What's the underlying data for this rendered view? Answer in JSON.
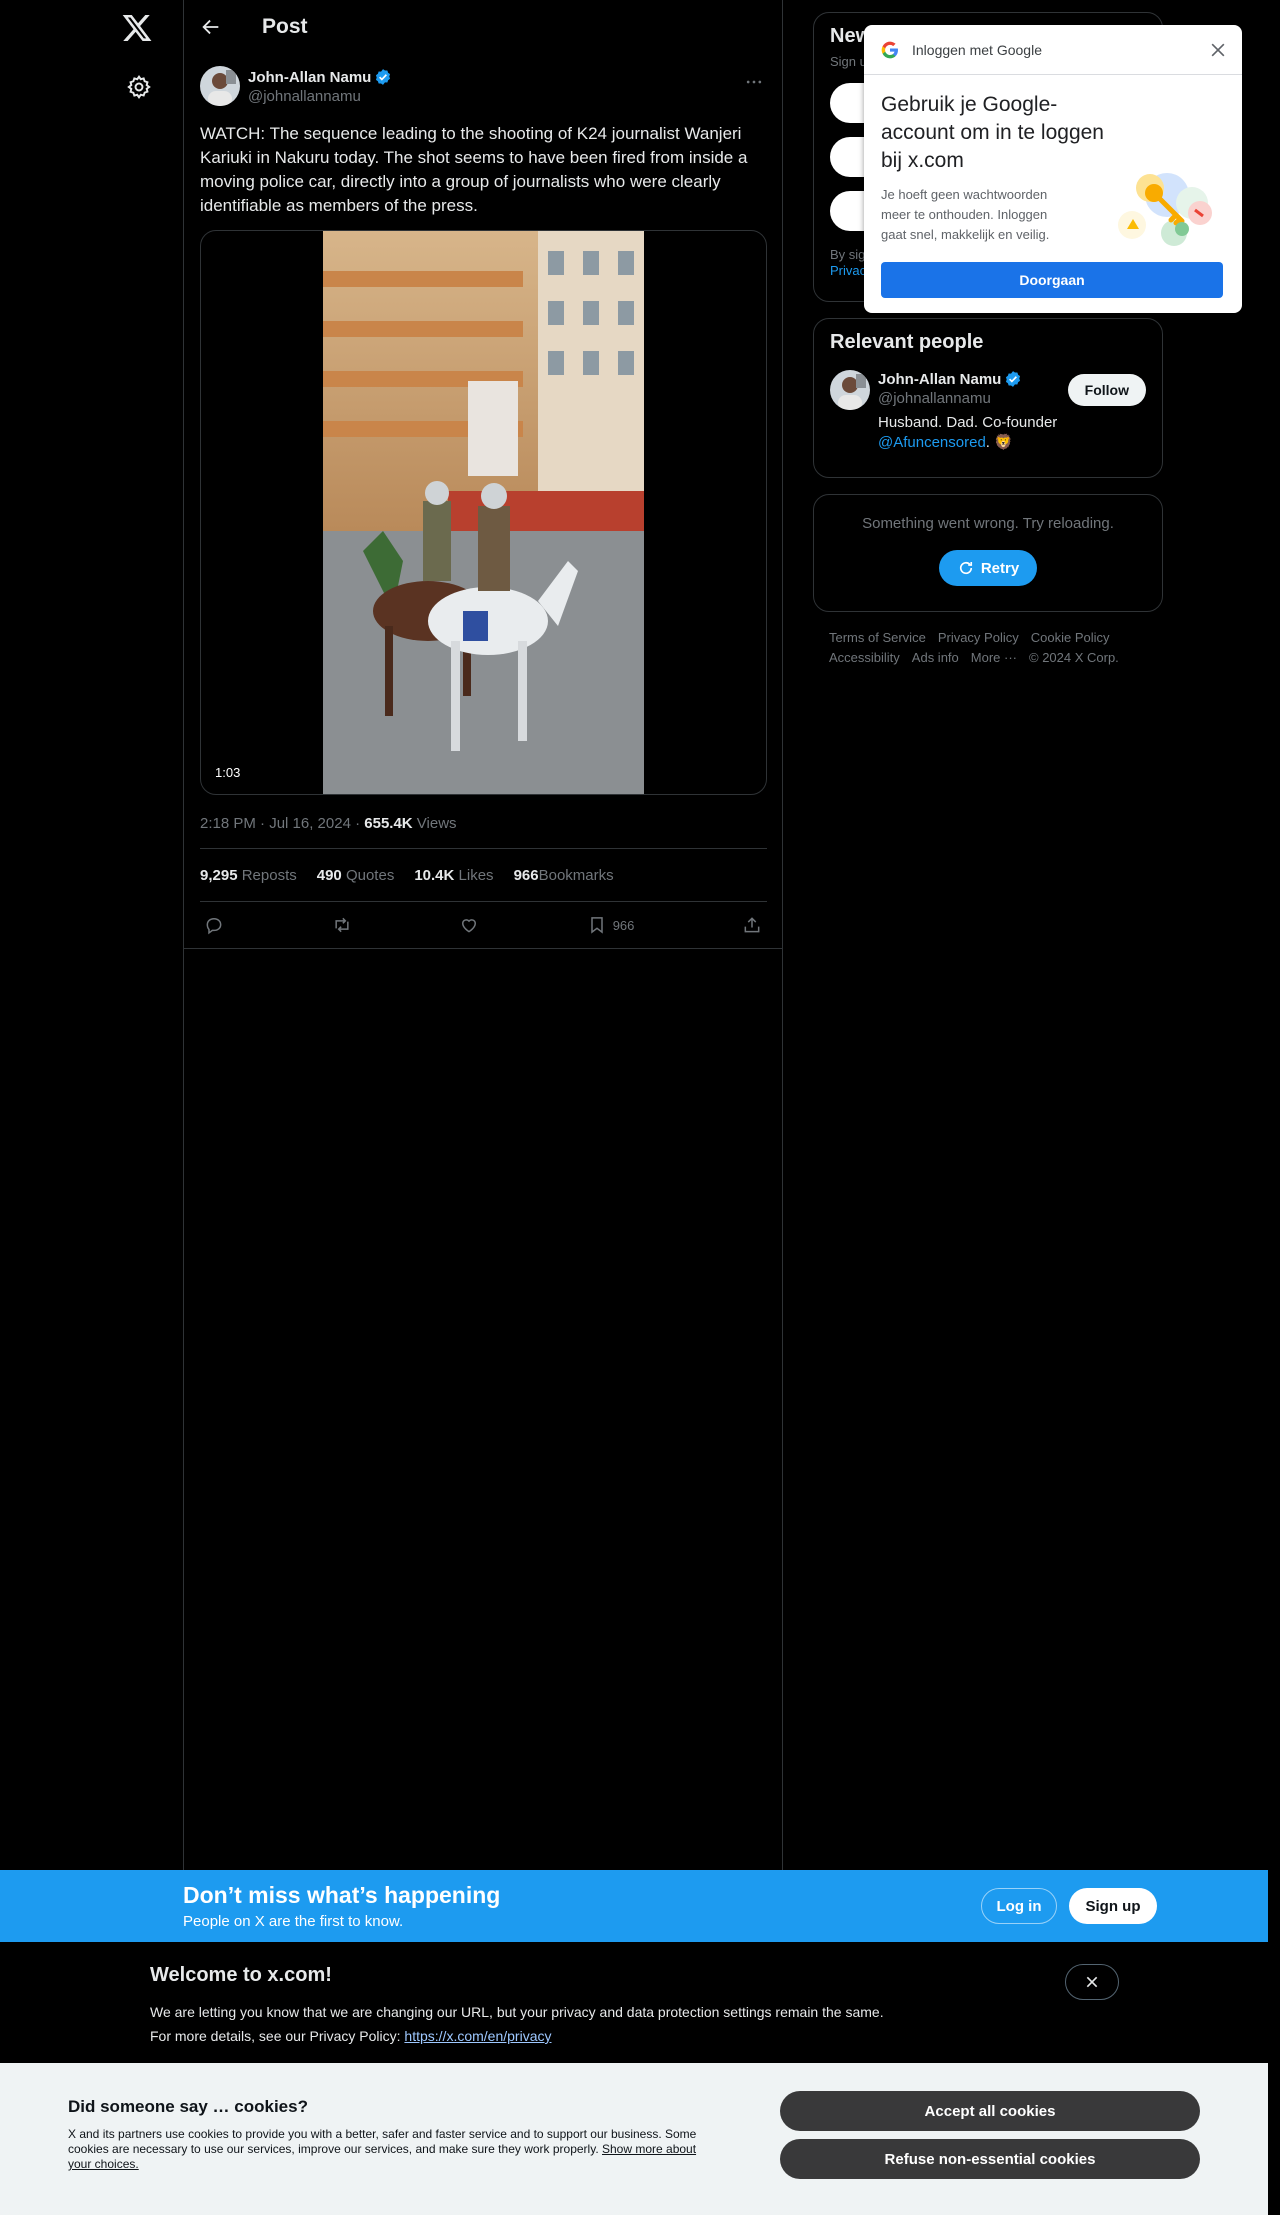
{
  "header": {
    "title": "Post"
  },
  "tweet": {
    "author_name": "John-Allan Namu",
    "author_handle": "@johnallannamu",
    "text": "WATCH: The sequence leading to the shooting of K24 journalist Wanjeri Kariuki in Nakuru today. The shot seems to have been fired from inside a moving police car, directly into a group of journalists who were clearly identifiable as members of the press.",
    "video_duration": "1:03",
    "time": "2:18 PM · Jul 16, 2024 · ",
    "views_count": "655.4K",
    "views_label": " Views",
    "stats": [
      {
        "count": "9,295",
        "label": "Reposts"
      },
      {
        "count": "490",
        "label": "Quotes"
      },
      {
        "count": "10.4K",
        "label": "Likes"
      },
      {
        "count": "966",
        "label": "Bookmarks"
      }
    ],
    "bookmark_count": "966"
  },
  "new_card": {
    "title": "New",
    "subtitle": "Sign u",
    "tos_prefix": "By sig",
    "tos_link": "Privac"
  },
  "relevant_people": {
    "title": "Relevant people",
    "name": "John-Allan Namu",
    "handle": "@johnallannamu",
    "bio": "Husband. Dad. Co-founder",
    "bio_mention": "@Afuncensored",
    "bio_suffix": ". 🦁",
    "follow_label": "Follow"
  },
  "error_card": {
    "message": "Something went wrong. Try reloading.",
    "retry_label": "Retry"
  },
  "footer": {
    "links": [
      "Terms of Service",
      "Privacy Policy",
      "Cookie Policy",
      "Accessibility",
      "Ads info",
      "More ···",
      "© 2024 X Corp."
    ]
  },
  "google_popup": {
    "header": "Inloggen met Google",
    "title": "Gebruik je Google-account om in te loggen bij x.com",
    "body": "Je hoeft geen wachtwoorden meer te onthouden. Inloggen gaat snel, makkelijk en veilig.",
    "button": "Doorgaan"
  },
  "dont_miss": {
    "title": "Don’t miss what’s happening",
    "subtitle": "People on X are the first to know.",
    "login": "Log in",
    "signup": "Sign up"
  },
  "welcome": {
    "title": "Welcome to x.com!",
    "line1": "We are letting you know that we are changing our URL, but your privacy and data protection settings remain the same.",
    "line2": "For more details, see our Privacy Policy: ",
    "link": "https://x.com/en/privacy"
  },
  "cookies": {
    "title": "Did someone say … cookies?",
    "text": "X and its partners use cookies to provide you with a better, safer and faster service and to support our business. Some cookies are necessary to use our services, improve our services, and make sure they work properly. ",
    "link": "Show more about your choices.",
    "accept": "Accept all cookies",
    "refuse": "Refuse non-essential cookies"
  },
  "colors": {
    "accent": "#1d9bf0",
    "background": "#000000",
    "text": "#e7e9ea",
    "muted": "#71767b",
    "google_blue": "#1a73e8",
    "cookie_bg": "#eff3f4"
  },
  "icons": [
    "x-logo-icon",
    "gear-icon",
    "back-arrow-icon",
    "verified-icon",
    "more-icon",
    "reply-icon",
    "repost-icon",
    "like-icon",
    "bookmark-icon",
    "share-icon",
    "retry-icon",
    "google-logo-icon",
    "close-icon"
  ]
}
